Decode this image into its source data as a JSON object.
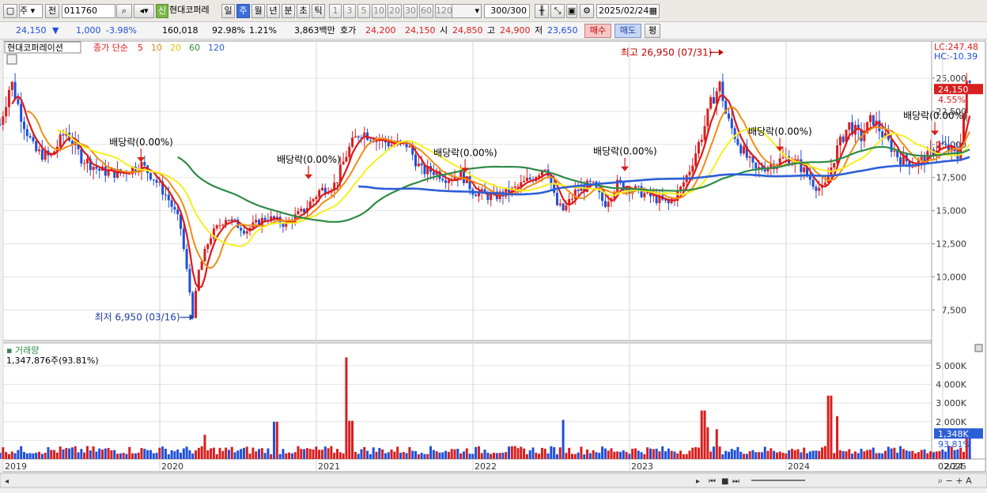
{
  "toolbar": {
    "mode_select": "주",
    "prev_label": "전",
    "code": "011760",
    "new_badge": "신",
    "stock_name": "현대코퍼레",
    "periods": [
      "일",
      "주",
      "월",
      "년",
      "분",
      "초",
      "틱"
    ],
    "selected_period": "주",
    "intervals": [
      "1",
      "3",
      "5",
      "10",
      "20",
      "30",
      "60",
      "120"
    ],
    "count": "300/300",
    "date": "2025/02/24"
  },
  "infobar": {
    "price": "24,150",
    "change_arrow": "▼",
    "change": "1,000",
    "change_pct": "-3.98%",
    "volume": "160,018",
    "vol_ratio": "92.98%",
    "turnover": "1.21%",
    "amount": "3,863백만",
    "quote_label": "호가",
    "ask": "24,200",
    "bid": "24,150",
    "open_label": "시",
    "open": "24,850",
    "high_label": "고",
    "high": "24,900",
    "low_label": "저",
    "low": "23,650",
    "buy_label": "매수",
    "sell_label": "매도",
    "eval_label": "평"
  },
  "colors": {
    "up": "#d81e1e",
    "down": "#1f4fd8",
    "ma5": "#e01818",
    "ma10": "#f08c14",
    "ma20": "#f5f01e",
    "ma60": "#2e8b46",
    "ma120": "#2c5fd6"
  },
  "chart_data": {
    "type": "candlestick",
    "title": "현대코퍼레이션",
    "ma_label": "종가 단순",
    "ma_periods": [
      5,
      10,
      20,
      60,
      120
    ],
    "x_labels": [
      "2019",
      "2020",
      "2021",
      "2022",
      "2023",
      "2024",
      "2025"
    ],
    "x_end_label": "02/24",
    "y_ticks": [
      7500,
      10000,
      12500,
      15000,
      17500,
      20000,
      22500,
      25000
    ],
    "y_tick_labels": [
      "7,500",
      "10,000",
      "12,500",
      "15,000",
      "17,500",
      "20,000",
      "22,500",
      "25,000"
    ],
    "ylim": [
      5200,
      27800
    ],
    "lc": "LC:247.48",
    "hc": "HC:-10.39",
    "current_price": "24,150",
    "current_pct": "4.55%",
    "high_annotation": "최고 26,950 (07/31)",
    "low_annotation": "최저 6,950 (03/16)",
    "dividends": [
      {
        "label": "배당락(0.00%)",
        "year": 2019.88,
        "price": 18500
      },
      {
        "label": "배당락(0.00%)",
        "year": 2020.95,
        "price": 17200
      },
      {
        "label": "배당락(0.00%)",
        "year": 2021.95,
        "price": 17700
      },
      {
        "label": "배당락(0.00%)",
        "year": 2022.97,
        "price": 17800
      },
      {
        "label": "배당락(0.00%)",
        "year": 2023.96,
        "price": 19300
      },
      {
        "label": "배당락(0.00%)",
        "year": 2024.95,
        "price": 20500
      }
    ],
    "price_keypoints": [
      [
        2018.98,
        21500
      ],
      [
        2019.05,
        24800
      ],
      [
        2019.12,
        22000
      ],
      [
        2019.2,
        19500
      ],
      [
        2019.3,
        19000
      ],
      [
        2019.4,
        21000
      ],
      [
        2019.5,
        19000
      ],
      [
        2019.62,
        18000
      ],
      [
        2019.75,
        17800
      ],
      [
        2019.88,
        18500
      ],
      [
        2019.96,
        17500
      ],
      [
        2020.05,
        16000
      ],
      [
        2020.13,
        14000
      ],
      [
        2020.19,
        9000
      ],
      [
        2020.21,
        7000
      ],
      [
        2020.25,
        10500
      ],
      [
        2020.32,
        13000
      ],
      [
        2020.42,
        14500
      ],
      [
        2020.55,
        13500
      ],
      [
        2020.68,
        14500
      ],
      [
        2020.8,
        14000
      ],
      [
        2020.92,
        15000
      ],
      [
        2021.02,
        16500
      ],
      [
        2021.12,
        17000
      ],
      [
        2021.2,
        19500
      ],
      [
        2021.28,
        21000
      ],
      [
        2021.38,
        20500
      ],
      [
        2021.48,
        20000
      ],
      [
        2021.58,
        20000
      ],
      [
        2021.67,
        18000
      ],
      [
        2021.75,
        18000
      ],
      [
        2021.83,
        17500
      ],
      [
        2021.93,
        17700
      ],
      [
        2022.0,
        16500
      ],
      [
        2022.12,
        16000
      ],
      [
        2022.25,
        16500
      ],
      [
        2022.38,
        17500
      ],
      [
        2022.47,
        18500
      ],
      [
        2022.53,
        15500
      ],
      [
        2022.58,
        15000
      ],
      [
        2022.66,
        16500
      ],
      [
        2022.76,
        17000
      ],
      [
        2022.84,
        15500
      ],
      [
        2022.92,
        17000
      ],
      [
        2023.05,
        16500
      ],
      [
        2023.15,
        16000
      ],
      [
        2023.25,
        15500
      ],
      [
        2023.32,
        16500
      ],
      [
        2023.38,
        18000
      ],
      [
        2023.47,
        21000
      ],
      [
        2023.53,
        23500
      ],
      [
        2023.58,
        24500
      ],
      [
        2023.62,
        22000
      ],
      [
        2023.7,
        20000
      ],
      [
        2023.8,
        18000
      ],
      [
        2023.9,
        18500
      ],
      [
        2024.0,
        19000
      ],
      [
        2024.08,
        18500
      ],
      [
        2024.18,
        17000
      ],
      [
        2024.24,
        16500
      ],
      [
        2024.32,
        19500
      ],
      [
        2024.4,
        21500
      ],
      [
        2024.48,
        20500
      ],
      [
        2024.55,
        22000
      ],
      [
        2024.63,
        20500
      ],
      [
        2024.72,
        19000
      ],
      [
        2024.82,
        18500
      ],
      [
        2024.9,
        19000
      ],
      [
        2024.98,
        20000
      ],
      [
        2025.05,
        19500
      ],
      [
        2025.1,
        19000
      ],
      [
        2025.14,
        23000
      ],
      [
        2025.16,
        25150
      ],
      [
        2025.18,
        24150
      ]
    ],
    "volume_panel": {
      "title": "거래량",
      "value_label": "1,347,876주(93.81%)",
      "y_ticks": [
        1000000,
        2000000,
        3000000,
        4000000,
        5000000
      ],
      "y_tick_labels": [
        "",
        "2,000K",
        "3,000K",
        "4,000K",
        "5,000K"
      ],
      "ylim": [
        0,
        5800000
      ],
      "current_label": "1,348K",
      "current_pct": "93.81%",
      "spikes": [
        [
          2021.2,
          5450000
        ],
        [
          2020.74,
          2000000
        ],
        [
          2021.22,
          2050000
        ],
        [
          2022.57,
          2100000
        ],
        [
          2023.47,
          2600000
        ],
        [
          2024.28,
          3400000
        ],
        [
          2024.32,
          2300000
        ],
        [
          2020.29,
          1300000
        ],
        [
          2023.5,
          1700000
        ],
        [
          2023.55,
          1600000
        ],
        [
          2025.15,
          1500000
        ],
        [
          2025.17,
          1348000
        ]
      ]
    }
  }
}
